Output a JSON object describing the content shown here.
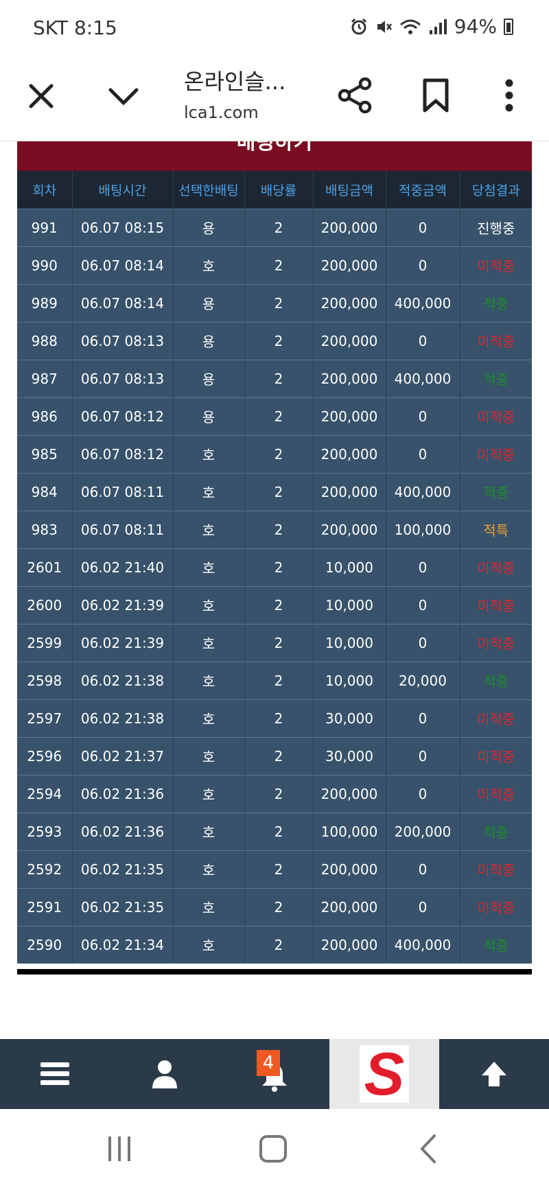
{
  "status_bar": {
    "carrier_time": "SKT 8:15",
    "battery": "94%"
  },
  "browser": {
    "title": "온라인슬...",
    "url": "lca1.com"
  },
  "bet_section": {
    "header": "배팅하기"
  },
  "table": {
    "columns": [
      "회차",
      "배팅시간",
      "선택한배팅",
      "배당률",
      "배팅금액",
      "적중금액",
      "당첨결과"
    ],
    "rows": [
      {
        "round": "991",
        "time": "06.07 08:15",
        "pick": "용",
        "odds": "2",
        "bet": "200,000",
        "win": "0",
        "result": "진행중",
        "status": "pending"
      },
      {
        "round": "990",
        "time": "06.07 08:14",
        "pick": "호",
        "odds": "2",
        "bet": "200,000",
        "win": "0",
        "result": "미적중",
        "status": "lose"
      },
      {
        "round": "989",
        "time": "06.07 08:14",
        "pick": "용",
        "odds": "2",
        "bet": "200,000",
        "win": "400,000",
        "result": "적중",
        "status": "win"
      },
      {
        "round": "988",
        "time": "06.07 08:13",
        "pick": "용",
        "odds": "2",
        "bet": "200,000",
        "win": "0",
        "result": "미적중",
        "status": "lose"
      },
      {
        "round": "987",
        "time": "06.07 08:13",
        "pick": "용",
        "odds": "2",
        "bet": "200,000",
        "win": "400,000",
        "result": "적중",
        "status": "win"
      },
      {
        "round": "986",
        "time": "06.07 08:12",
        "pick": "용",
        "odds": "2",
        "bet": "200,000",
        "win": "0",
        "result": "미적중",
        "status": "lose"
      },
      {
        "round": "985",
        "time": "06.07 08:12",
        "pick": "호",
        "odds": "2",
        "bet": "200,000",
        "win": "0",
        "result": "미적중",
        "status": "lose"
      },
      {
        "round": "984",
        "time": "06.07 08:11",
        "pick": "호",
        "odds": "2",
        "bet": "200,000",
        "win": "400,000",
        "result": "적중",
        "status": "win"
      },
      {
        "round": "983",
        "time": "06.07 08:11",
        "pick": "호",
        "odds": "2",
        "bet": "200,000",
        "win": "100,000",
        "result": "적특",
        "status": "special"
      },
      {
        "round": "2601",
        "time": "06.02 21:40",
        "pick": "호",
        "odds": "2",
        "bet": "10,000",
        "win": "0",
        "result": "미적중",
        "status": "lose"
      },
      {
        "round": "2600",
        "time": "06.02 21:39",
        "pick": "호",
        "odds": "2",
        "bet": "10,000",
        "win": "0",
        "result": "미적중",
        "status": "lose"
      },
      {
        "round": "2599",
        "time": "06.02 21:39",
        "pick": "호",
        "odds": "2",
        "bet": "10,000",
        "win": "0",
        "result": "미적중",
        "status": "lose"
      },
      {
        "round": "2598",
        "time": "06.02 21:38",
        "pick": "호",
        "odds": "2",
        "bet": "10,000",
        "win": "20,000",
        "result": "적중",
        "status": "win"
      },
      {
        "round": "2597",
        "time": "06.02 21:38",
        "pick": "호",
        "odds": "2",
        "bet": "30,000",
        "win": "0",
        "result": "미적중",
        "status": "lose"
      },
      {
        "round": "2596",
        "time": "06.02 21:37",
        "pick": "호",
        "odds": "2",
        "bet": "30,000",
        "win": "0",
        "result": "미적중",
        "status": "lose"
      },
      {
        "round": "2594",
        "time": "06.02 21:36",
        "pick": "호",
        "odds": "2",
        "bet": "200,000",
        "win": "0",
        "result": "미적중",
        "status": "lose"
      },
      {
        "round": "2593",
        "time": "06.02 21:36",
        "pick": "호",
        "odds": "2",
        "bet": "100,000",
        "win": "200,000",
        "result": "적중",
        "status": "win"
      },
      {
        "round": "2592",
        "time": "06.02 21:35",
        "pick": "호",
        "odds": "2",
        "bet": "200,000",
        "win": "0",
        "result": "미적중",
        "status": "lose"
      },
      {
        "round": "2591",
        "time": "06.02 21:35",
        "pick": "호",
        "odds": "2",
        "bet": "200,000",
        "win": "0",
        "result": "미적중",
        "status": "lose"
      },
      {
        "round": "2590",
        "time": "06.02 21:34",
        "pick": "호",
        "odds": "2",
        "bet": "200,000",
        "win": "400,000",
        "result": "적중",
        "status": "win"
      }
    ]
  },
  "bottom_nav": {
    "notification_count": "4",
    "logo_letter": "S"
  },
  "colors": {
    "header_bg": "#7a0d22",
    "table_head_bg": "#1c2733",
    "table_head_text": "#4ea1e6",
    "row_bg": "#37526a",
    "lose": "#e2242f",
    "win": "#1c8d2a",
    "special": "#f0a233",
    "nav_bg": "#2b3a48"
  },
  "icons": {
    "close": "close-icon",
    "chevron": "chevron-down-icon",
    "share": "share-icon",
    "bookmark": "bookmark-icon",
    "more": "more-vertical-icon",
    "menu": "menu-icon",
    "user": "user-icon",
    "bell": "bell-icon",
    "arrow_up": "arrow-up-icon"
  }
}
